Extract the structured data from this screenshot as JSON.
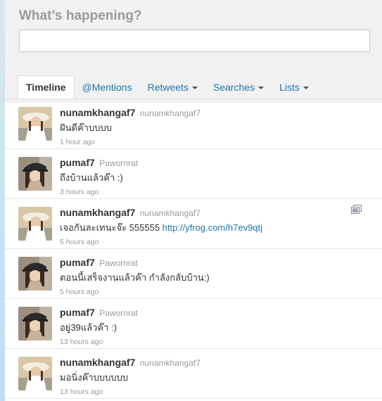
{
  "composer": {
    "title": "What’s happening?",
    "placeholder": ""
  },
  "tabs": [
    {
      "label": "Timeline",
      "dropdown": false,
      "active": true
    },
    {
      "label": "@Mentions",
      "dropdown": false,
      "active": false
    },
    {
      "label": "Retweets",
      "dropdown": true,
      "active": false
    },
    {
      "label": "Searches",
      "dropdown": true,
      "active": false
    },
    {
      "label": "Lists",
      "dropdown": true,
      "active": false
    }
  ],
  "tweets": [
    {
      "screen_name": "nunamkhangaf7",
      "full_name": "nunamkhangaf7",
      "text": "ฝันดีค๊าบบบบ",
      "link": "",
      "time": "1 hour ago",
      "has_media": false,
      "avatar": "girl-in-sun-hat-avatar"
    },
    {
      "screen_name": "pumaf7",
      "full_name": "Pawornrat",
      "text": "ถึงบ้านแล้วค๊า :)",
      "link": "",
      "time": "3 hours ago",
      "has_media": false,
      "avatar": "girl-in-cap-avatar"
    },
    {
      "screen_name": "nunamkhangaf7",
      "full_name": "nunamkhangaf7",
      "text": "เจอกันละเทนะจ๊ะ 555555 ",
      "link": "http://yfrog.com/h7ev9qtj",
      "time": "5 hours ago",
      "has_media": true,
      "avatar": "girl-in-sun-hat-avatar"
    },
    {
      "screen_name": "pumaf7",
      "full_name": "Pawornrat",
      "text": "ตอนนี้เสร็จงานแล้วค๊า กำลังกลับบ้าน:)",
      "link": "",
      "time": "5 hours ago",
      "has_media": false,
      "avatar": "girl-in-cap-avatar"
    },
    {
      "screen_name": "pumaf7",
      "full_name": "Pawornrat",
      "text": "อยู่39แล้วค๊า :)",
      "link": "",
      "time": "13 hours ago",
      "has_media": false,
      "avatar": "girl-in-cap-avatar"
    },
    {
      "screen_name": "nunamkhangaf7",
      "full_name": "nunamkhangaf7",
      "text": "มอนิ่งค๊าบบบบบบ",
      "link": "",
      "time": "13 hours ago",
      "has_media": false,
      "avatar": "girl-in-sun-hat-avatar"
    }
  ],
  "colors": {
    "link": "#2176a8",
    "text": "#333333",
    "muted": "#999999",
    "composer_bg": "#f1f1f1"
  }
}
